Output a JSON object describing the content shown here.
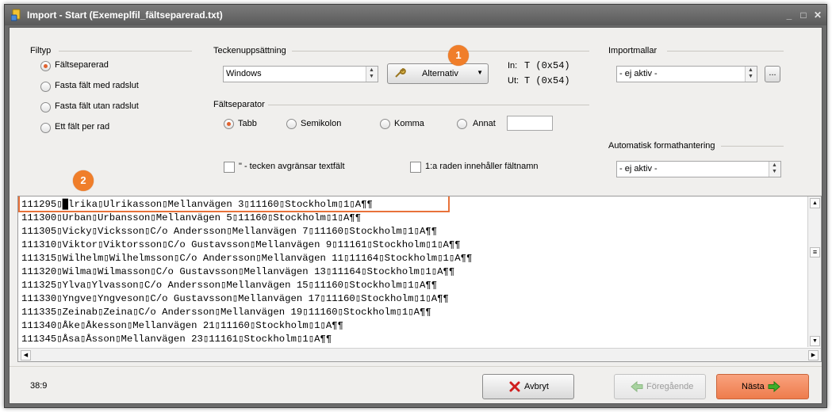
{
  "window": {
    "title": "Import - Start  (Exemeplfil_fältseparerad.txt)",
    "buttons": {
      "minimize": "_",
      "maximize": "□",
      "close": "✕"
    }
  },
  "filetype": {
    "legend": "Filtyp",
    "options": [
      "Fältseparerad",
      "Fasta fält med radslut",
      "Fasta fält utan radslut",
      "Ett fält per rad"
    ],
    "selected_index": 0
  },
  "charset": {
    "legend": "Teckenuppsättning",
    "value": "Windows",
    "options_button": "Alternativ",
    "in_label": "In:",
    "in_value": "T (0x54)",
    "out_label": "Ut:",
    "out_value": "T (0x54)"
  },
  "separator": {
    "legend": "Fältseparator",
    "options": [
      "Tabb",
      "Semikolon",
      "Komma",
      "Annat"
    ],
    "selected_index": 0,
    "other_value": ""
  },
  "checkboxes": {
    "quote": "\" - tecken avgränsar textfält",
    "header_row": "1:a raden innehåller fältnamn"
  },
  "templates": {
    "legend": "Importmallar",
    "value": "- ej aktiv -",
    "browse": "..."
  },
  "autoformat": {
    "legend": "Automatisk formathantering",
    "value": "- ej aktiv -"
  },
  "callouts": {
    "c1": "1",
    "c2": "2"
  },
  "preview": {
    "lines": [
      "111295▯█lrika▯Ulrikasson▯Mellanvägen 3▯11160▯Stockholm▯1▯A¶¶",
      "111300▯Urban▯Urbansson▯Mellanvägen 5▯11160▯Stockholm▯1▯A¶¶",
      "111305▯Vicky▯Vicksson▯C/o Andersson▯Mellanvägen 7▯11160▯Stockholm▯1▯A¶¶",
      "111310▯Viktor▯Viktorsson▯C/o Gustavsson▯Mellanvägen 9▯11161▯Stockholm▯1▯A¶¶",
      "111315▯Wilhelm▯Wilhelmsson▯C/o Andersson▯Mellanvägen 11▯11164▯Stockholm▯1▯A¶¶",
      "111320▯Wilma▯Wilmasson▯C/o Gustavsson▯Mellanvägen 13▯11164▯Stockholm▯1▯A¶¶",
      "111325▯Ylva▯Ylvasson▯C/o Andersson▯Mellanvägen 15▯11160▯Stockholm▯1▯A¶¶",
      "111330▯Yngve▯Yngveson▯C/o Gustavsson▯Mellanvägen 17▯11160▯Stockholm▯1▯A¶¶",
      "111335▯Zeinab▯Zeina▯C/o Andersson▯Mellanvägen 19▯11160▯Stockholm▯1▯A¶¶",
      "111340▯Åke▯Åkesson▯Mellanvägen 21▯11160▯Stockholm▯1▯A¶¶",
      "111345▯Åsa▯Åsson▯Mellanvägen 23▯11161▯Stockholm▯1▯A¶¶"
    ]
  },
  "status": {
    "cursor_position": "38:9"
  },
  "footer": {
    "cancel": "Avbryt",
    "previous": "Föregående",
    "next": "Nästa"
  },
  "colors": {
    "accent": "#f07e2a",
    "highlight_border": "#e8723a"
  }
}
